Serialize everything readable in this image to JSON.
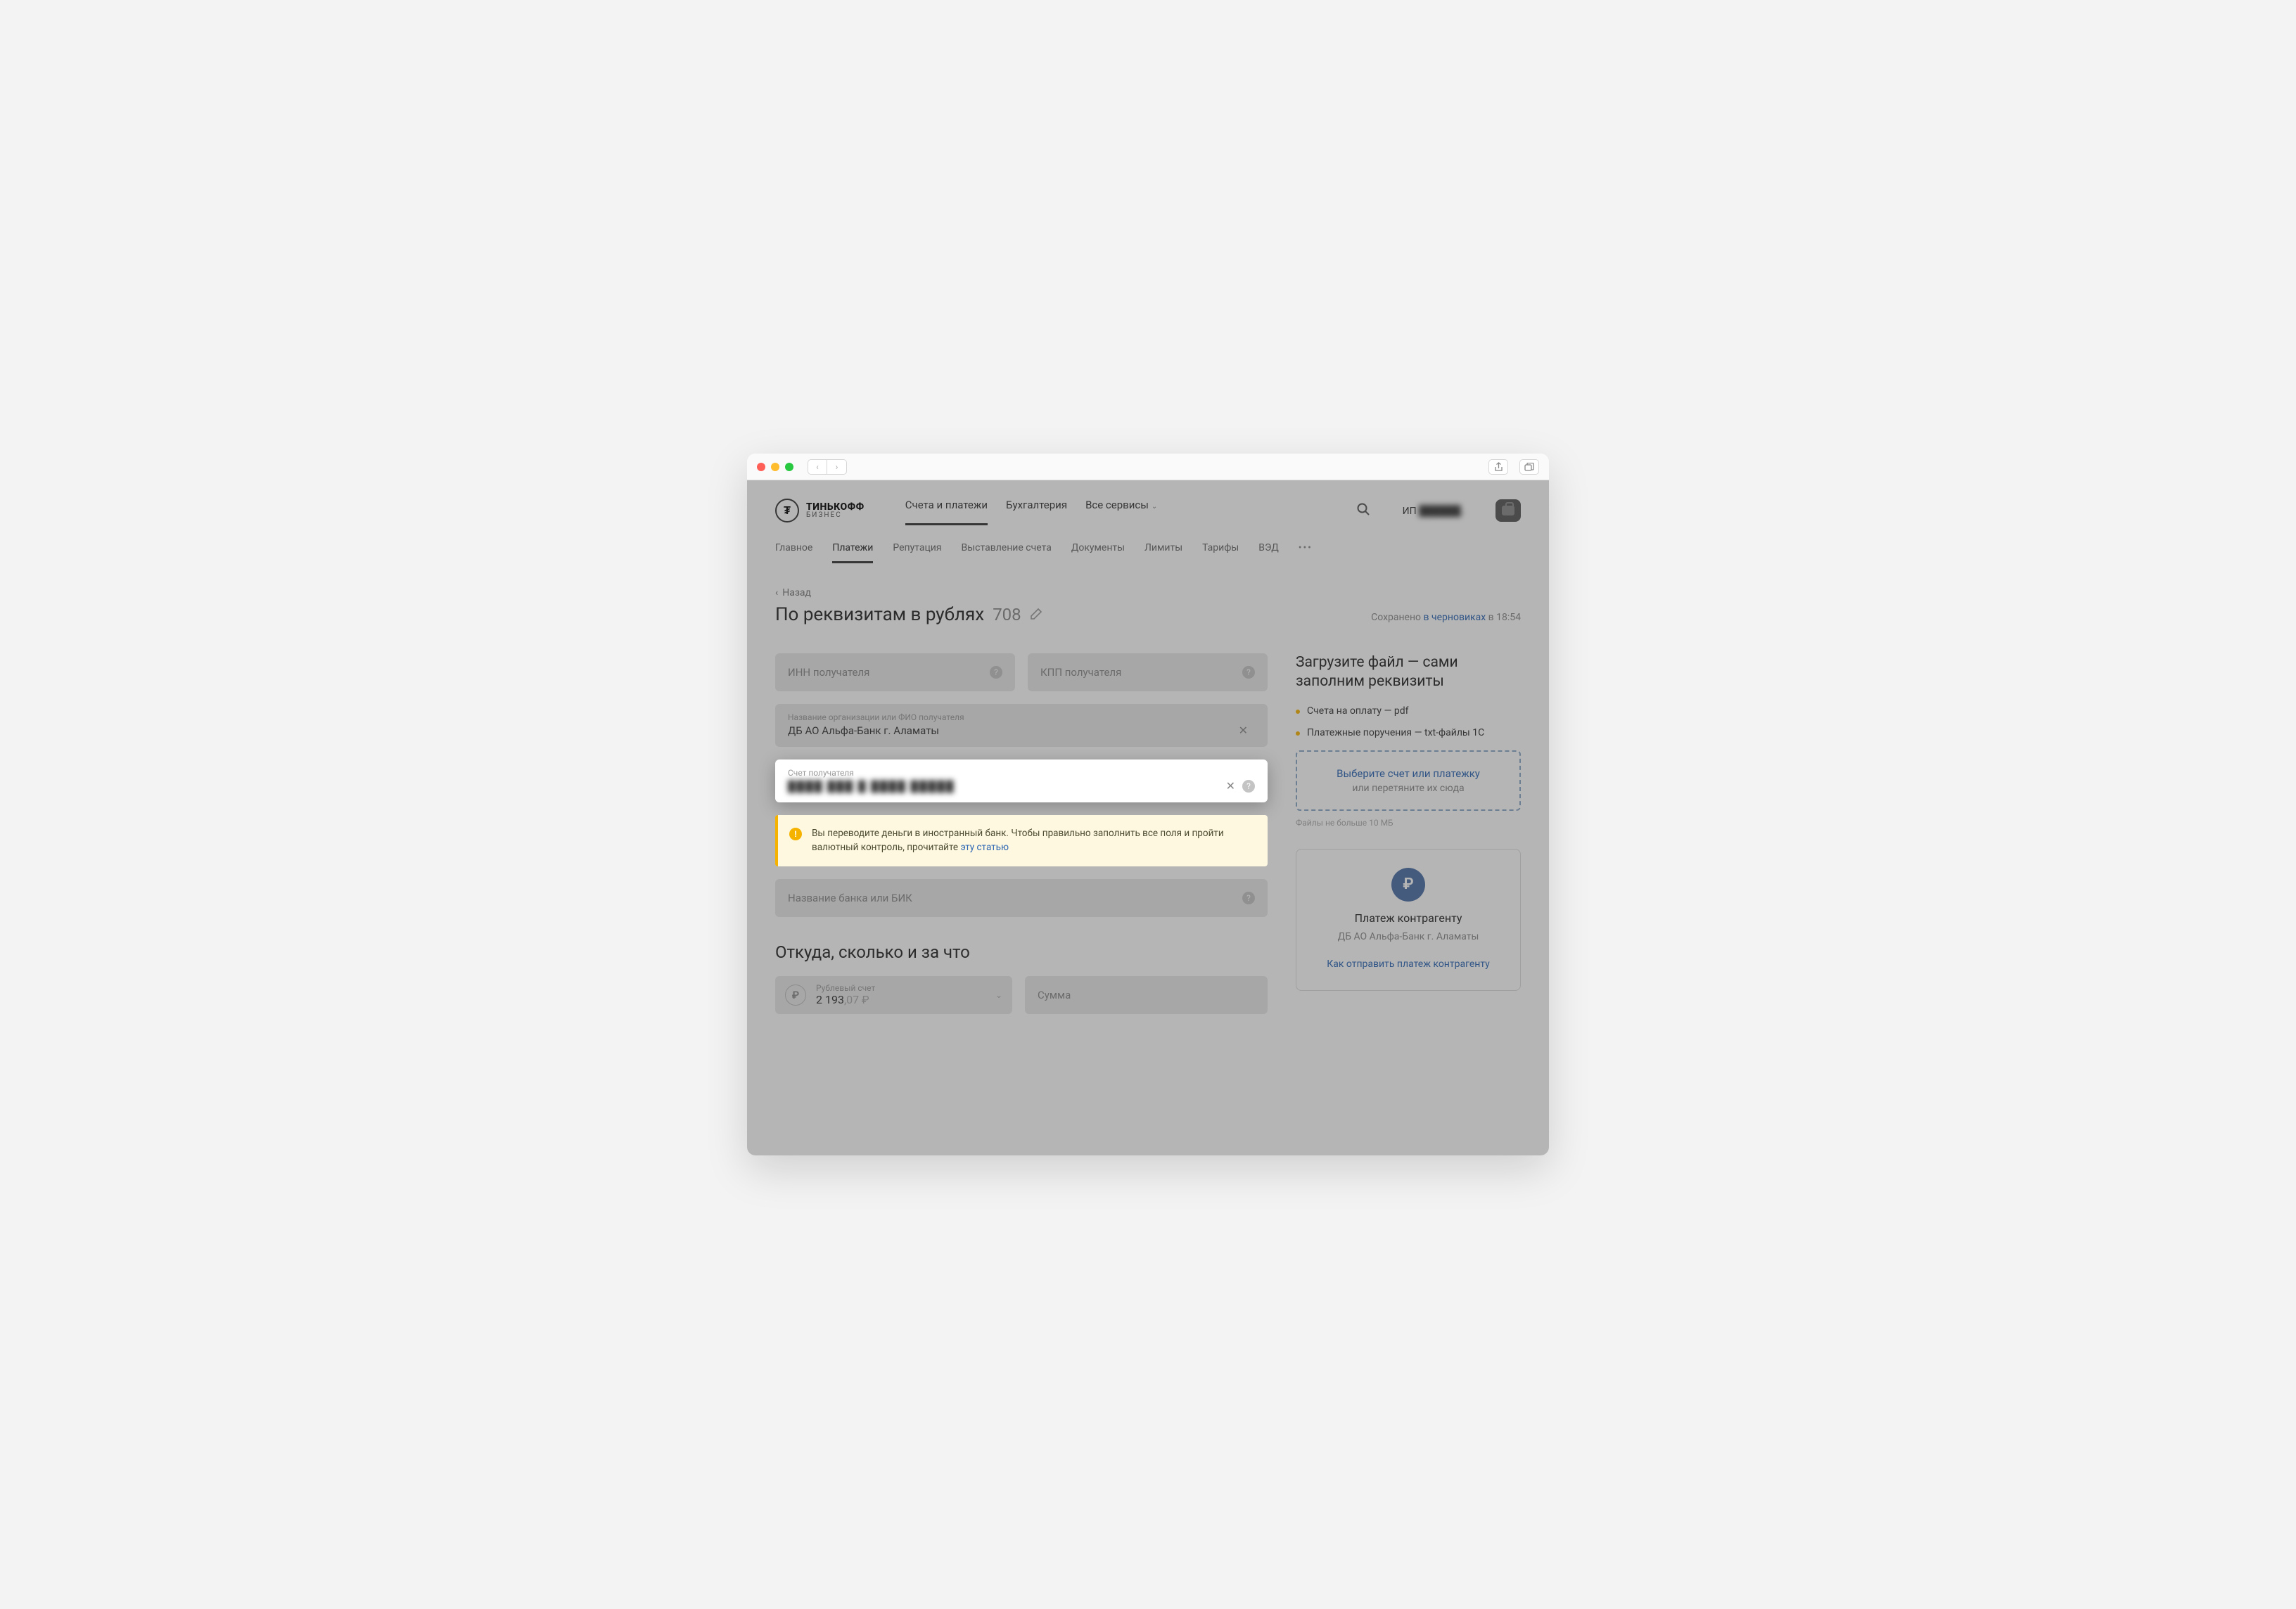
{
  "header": {
    "logo_l1": "ТИНЬКОФФ",
    "logo_l2": "БИЗНЕС",
    "top_nav": [
      {
        "label": "Счета и платежи",
        "active": true
      },
      {
        "label": "Бухгалтерия"
      },
      {
        "label": "Все сервисы",
        "dropdown": true
      }
    ],
    "company_prefix": "ИП ",
    "company_masked": "██████.."
  },
  "sub_nav": [
    {
      "label": "Главное"
    },
    {
      "label": "Платежи",
      "active": true
    },
    {
      "label": "Репутация"
    },
    {
      "label": "Выставление счета"
    },
    {
      "label": "Документы"
    },
    {
      "label": "Лимиты"
    },
    {
      "label": "Тарифы"
    },
    {
      "label": "ВЭД"
    }
  ],
  "back_label": "Назад",
  "page_title": "По реквизитам в рублях",
  "page_number": "708",
  "saved": {
    "prefix": "Сохранено ",
    "link": "в черновиках",
    "suffix": " в 18:54"
  },
  "fields": {
    "inn_placeholder": "ИНН получателя",
    "kpp_placeholder": "КПП получателя",
    "org_label": "Название организации или ФИО получателя",
    "org_value": "ДБ АО Альфа-Банк г. Аламаты",
    "acct_no_label": "Счет получателя",
    "acct_no_masked": "████  ███ █ ████ █████",
    "bank_placeholder": "Название банка или БИК"
  },
  "warning": {
    "text": "Вы переводите деньги в иностранный банк. Чтобы правильно заполнить все поля и пройти валютный контроль, прочитайте ",
    "link": "эту статью"
  },
  "section2_title": "Откуда, сколько и за что",
  "source_account": {
    "label": "Рублевый счет",
    "amount_int": "2 193",
    "amount_dec": ",07 ₽"
  },
  "sum_placeholder": "Сумма",
  "upload": {
    "title": "Загрузите файл — сами заполним реквизиты",
    "bullets": [
      "Счета на оплату — pdf",
      "Платежные поручения — txt-файлы 1С"
    ],
    "drop_link": "Выберите счет или платежку",
    "drop_sub": "или перетяните их сюда",
    "note": "Файлы не больше 10 МБ"
  },
  "card": {
    "title": "Платеж контрагенту",
    "sub": "ДБ АО Альфа-Банк г. Аламаты",
    "link": "Как отправить платеж контрагенту"
  }
}
